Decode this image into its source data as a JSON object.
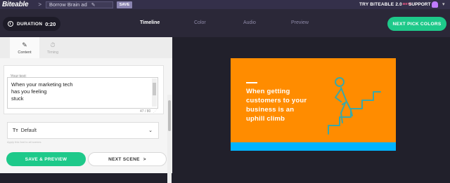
{
  "topbar": {
    "logo": "Biteable",
    "breadcrumb_sep": ">",
    "project_name": "Borrow Brain ad",
    "save_label": "SAVE",
    "try_label": "TRY BITEABLE 2.0",
    "beta_label": "BETA",
    "support_label": "SUPPORT"
  },
  "subbar": {
    "duration_label": "DURATION",
    "duration_value": "0:20",
    "tabs": [
      {
        "label": "Timeline",
        "active": true
      },
      {
        "label": "Color",
        "active": false
      },
      {
        "label": "Audio",
        "active": false
      },
      {
        "label": "Preview",
        "active": false
      }
    ],
    "next_label": "NEXT PICK COLORS"
  },
  "panel": {
    "tabs": [
      {
        "label": "Content",
        "icon": "pencil-icon",
        "active": true
      },
      {
        "label": "Timing",
        "icon": "stopwatch-icon",
        "active": false
      }
    ],
    "text_legend": "Your text",
    "text_lines": [
      "When your marketing tech",
      "has you feeling",
      "stuck"
    ],
    "char_count": "47 / 80",
    "font_icon": "Tт",
    "font_name": "Default",
    "hint": "Apply this font to all scenes",
    "save_preview_label": "SAVE & PREVIEW",
    "next_scene_label": "NEXT SCENE",
    "next_scene_arrow": ">"
  },
  "preview": {
    "lines": [
      "When getting",
      "customers to your",
      "business is an",
      "uphill climb"
    ],
    "bg_color": "#ff8c00",
    "stripe_color": "#00b4ff",
    "icon": "person-climbing-stairs-icon"
  },
  "colors": {
    "accent_green": "#1ec98a",
    "topbar": "#34304a",
    "workspace": "#21202b"
  }
}
